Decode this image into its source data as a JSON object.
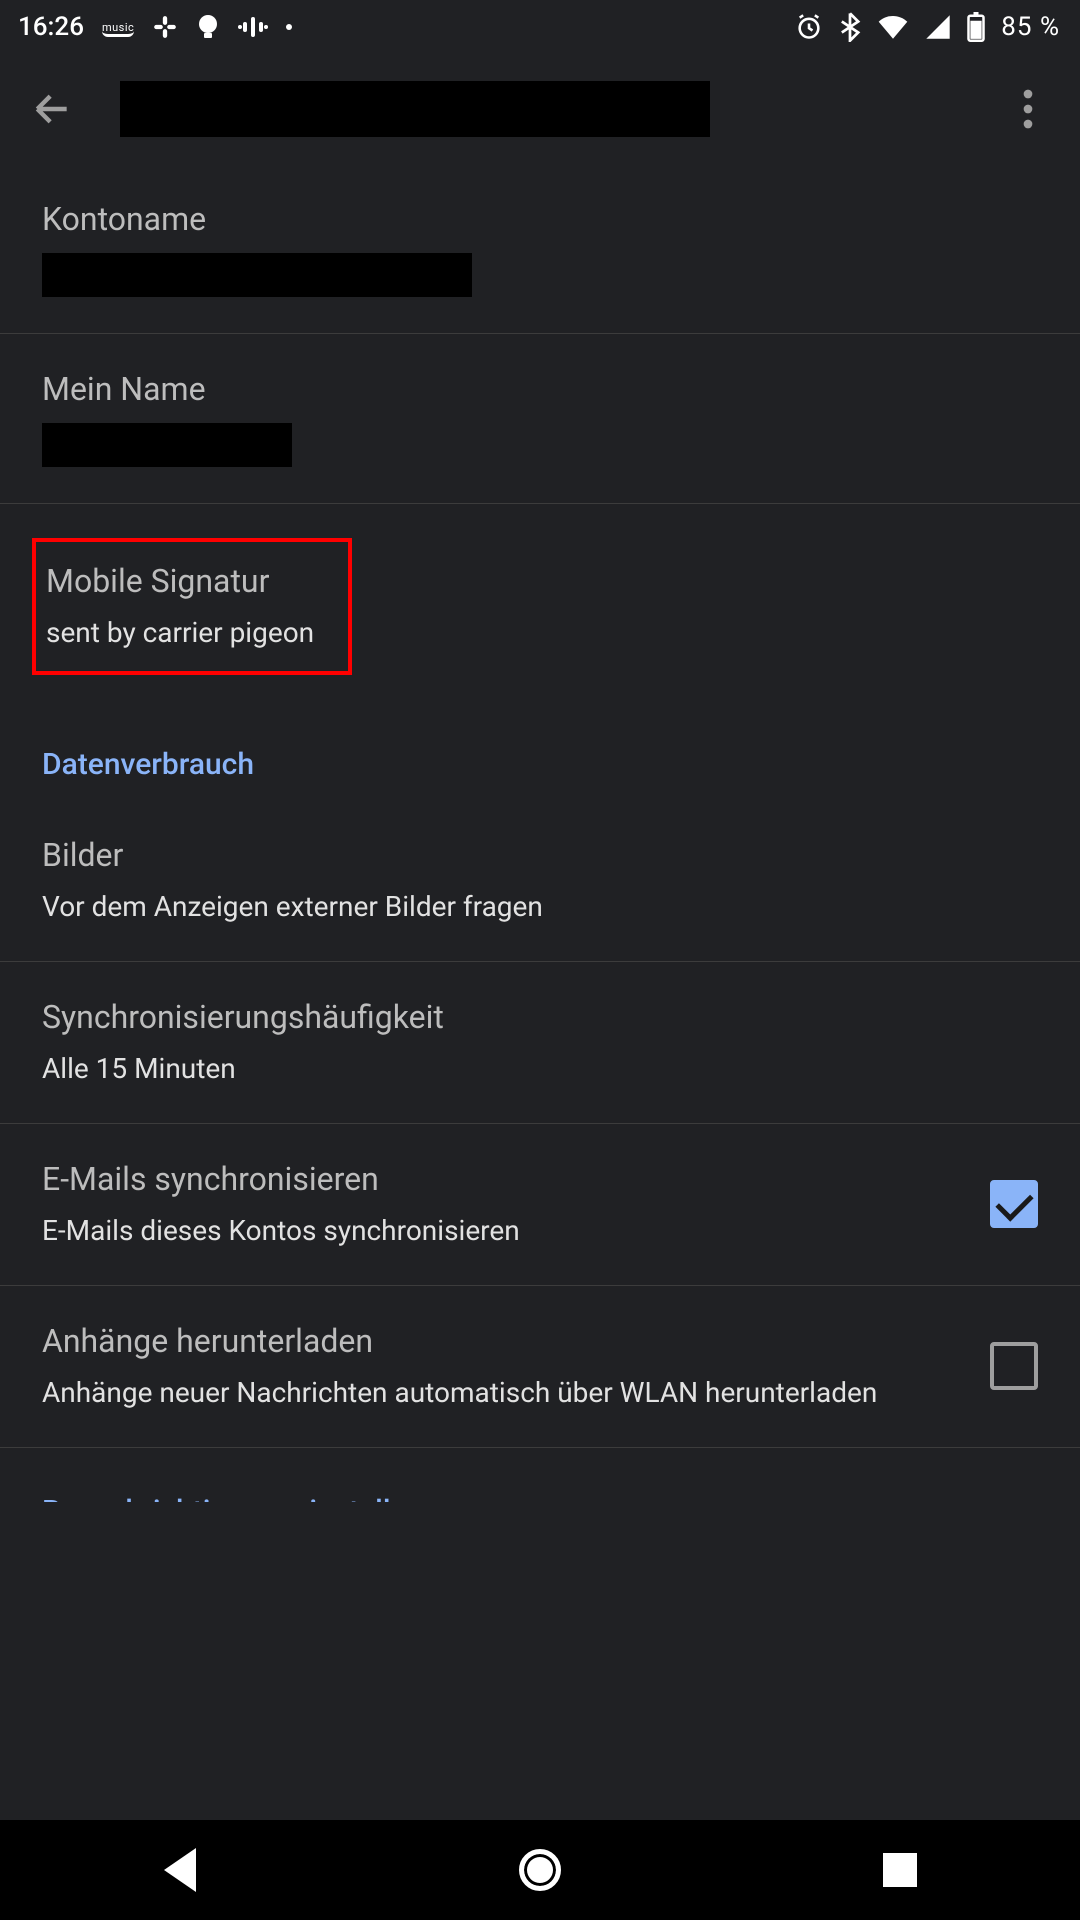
{
  "status": {
    "time": "16:26",
    "battery": "85 %"
  },
  "settings": {
    "account_name": {
      "title": "Kontoname"
    },
    "my_name": {
      "title": "Mein Name"
    },
    "signature": {
      "title": "Mobile Signatur",
      "value": "sent by carrier pigeon"
    },
    "section_data_usage": "Datenverbrauch",
    "images": {
      "title": "Bilder",
      "sub": "Vor dem Anzeigen externer Bilder fragen"
    },
    "sync_freq": {
      "title": "Synchronisierungshäufigkeit",
      "sub": "Alle 15 Minuten"
    },
    "sync_emails": {
      "title": "E-Mails synchronisieren",
      "sub": "E-Mails dieses Kontos synchronisieren",
      "checked": true
    },
    "download_att": {
      "title": "Anhänge herunterladen",
      "sub": "Anhänge neuer Nachrichten automatisch über WLAN herunterladen",
      "checked": false
    },
    "section_notifications": "Benachrichtigungseinstellungen"
  }
}
